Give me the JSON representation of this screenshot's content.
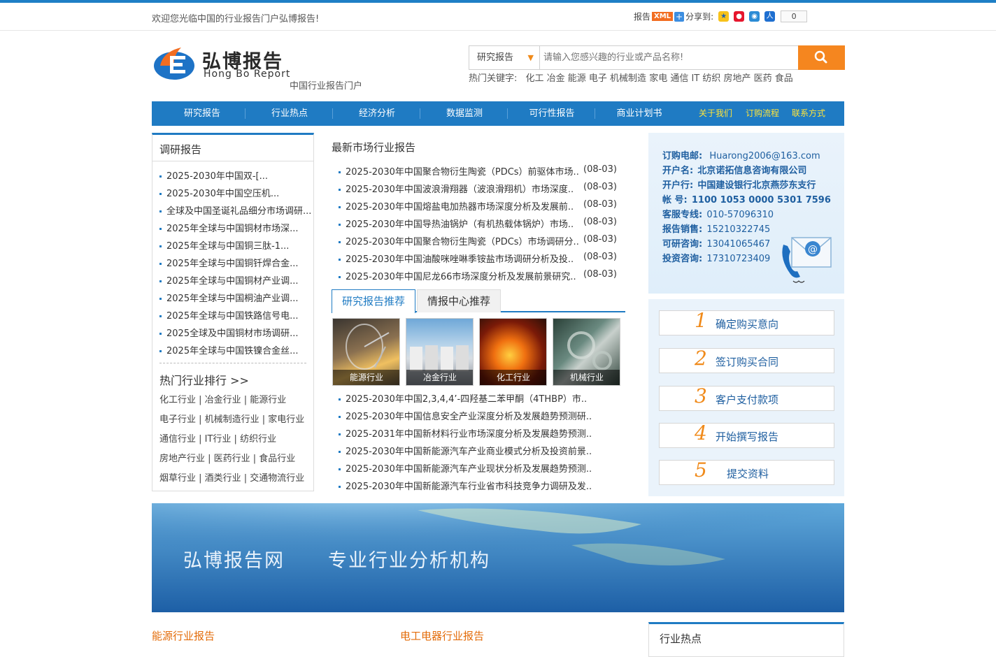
{
  "header": {
    "welcome": "欢迎您光临中国的行业报告门户弘博报告!",
    "report_label": "报告",
    "xml_badge": "XML",
    "share_label": "分享到:",
    "share_count": "0",
    "share_icons": [
      "qzone-icon",
      "weibo-icon",
      "tencent-icon",
      "renren-icon"
    ]
  },
  "logo": {
    "cn": "弘博报告",
    "en": "Hong Bo Report",
    "tagline": "中国行业报告门户"
  },
  "search": {
    "category": "研究报告",
    "placeholder": "请输入您感兴趣的行业或产品名称!",
    "hot_label": "热门关键字:",
    "hot_keywords": "化工 冶金 能源 电子 机械制造 家电 通信 IT 纺织 房地产 医药 食品"
  },
  "nav": {
    "items": [
      "研究报告",
      "行业热点",
      "经济分析",
      "数据监测",
      "可行性报告",
      "商业计划书"
    ],
    "links": [
      "关于我们",
      "订购流程",
      "联系方式"
    ]
  },
  "left": {
    "title": "调研报告",
    "items": [
      "2025-2030年中国双-[...",
      "2025-2030年中国空压机...",
      "全球及中国圣诞礼品细分市场调研...",
      "2025年全球与中国铜材市场深...",
      "2025年全球与中国铜三肽-1...",
      "2025年全球与中国铜钎焊合金...",
      "2025年全球与中国铜材产业调...",
      "2025年全球与中国桐油产业调...",
      "2025年全球与中国铁路信号电...",
      "2025全球及中国铜材市场调研...",
      "2025年全球与中国铁镍合金丝..."
    ],
    "rank_title": "热门行业排行 >>",
    "rank_rows": [
      "化工行业 | 冶金行业 | 能源行业",
      "电子行业 | 机械制造行业 | 家电行业",
      "通信行业 | IT行业 | 纺织行业",
      "房地产行业 | 医药行业 | 食品行业",
      "烟草行业 | 酒类行业 | 交通物流行业"
    ]
  },
  "middle": {
    "title": "最新市场行业报告",
    "latest": [
      {
        "t": "2025-2030年中国聚合物衍生陶瓷（PDCs）前驱体市场..",
        "d": "(08-03)"
      },
      {
        "t": "2025-2030年中国波浪滑翔器（波浪滑翔机）市场深度..",
        "d": "(08-03)"
      },
      {
        "t": "2025-2030年中国熔盐电加热器市场深度分析及发展前..",
        "d": "(08-03)"
      },
      {
        "t": "2025-2030年中国导热油锅炉（有机热载体锅炉）市场..",
        "d": "(08-03)"
      },
      {
        "t": "2025-2030年中国聚合物衍生陶瓷（PDCs）市场调研分..",
        "d": "(08-03)"
      },
      {
        "t": "2025-2030年中国油酸咪唑啉季铵盐市场调研分析及投..",
        "d": "(08-03)"
      },
      {
        "t": "2025-2030年中国尼龙66市场深度分析及发展前景研究..",
        "d": "(08-03)"
      }
    ],
    "tabs": [
      "研究报告推荐",
      "情报中心推荐"
    ],
    "thumbs": [
      "能源行业",
      "冶金行业",
      "化工行业",
      "机械行业"
    ],
    "recommend": [
      "2025-2030年中国2,3,4,4’-四羟基二苯甲酮（4THBP）市..",
      "2025-2030年中国信息安全产业深度分析及发展趋势预测研..",
      "2025-2031年中国新材料行业市场深度分析及发展趋势预测..",
      "2025-2030年中国新能源汽车产业商业模式分析及投资前景..",
      "2025-2030年中国新能源汽车产业现状分析及发展趋势预测..",
      "2025-2030年中国新能源汽车行业省市科技竞争力调研及发.."
    ]
  },
  "contact": [
    {
      "k": "订购电邮:",
      "v": "Huarong2006@163.com"
    },
    {
      "k": "开户名:",
      "v": "北京诺拓信息咨询有限公司"
    },
    {
      "k": "开户行:",
      "v": "中国建设银行北京燕莎东支行"
    },
    {
      "k": "帐 号:",
      "v": "1100 1053 0000 5301 7596"
    },
    {
      "k": "客服专线:",
      "v": "010-57096310"
    },
    {
      "k": "报告销售:",
      "v": "15210322745"
    },
    {
      "k": "可研咨询:",
      "v": "13041065467"
    },
    {
      "k": "投资咨询:",
      "v": "17310723409"
    }
  ],
  "steps": [
    {
      "n": "1",
      "t": "确定购买意向"
    },
    {
      "n": "2",
      "t": "签订购买合同"
    },
    {
      "n": "3",
      "t": "客户支付款项"
    },
    {
      "n": "4",
      "t": "开始撰写报告"
    },
    {
      "n": "5",
      "t": "提交资料"
    }
  ],
  "banner": {
    "t1": "弘博报告网",
    "t2": "专业行业分析机构"
  },
  "bottom": {
    "s1": "能源行业报告",
    "s2": "电工电器行业报告",
    "hot": "行业热点"
  },
  "colors": {
    "nav": "#1f7bc3",
    "accent": "#f5861f",
    "link_yellow": "#ffe43a"
  }
}
